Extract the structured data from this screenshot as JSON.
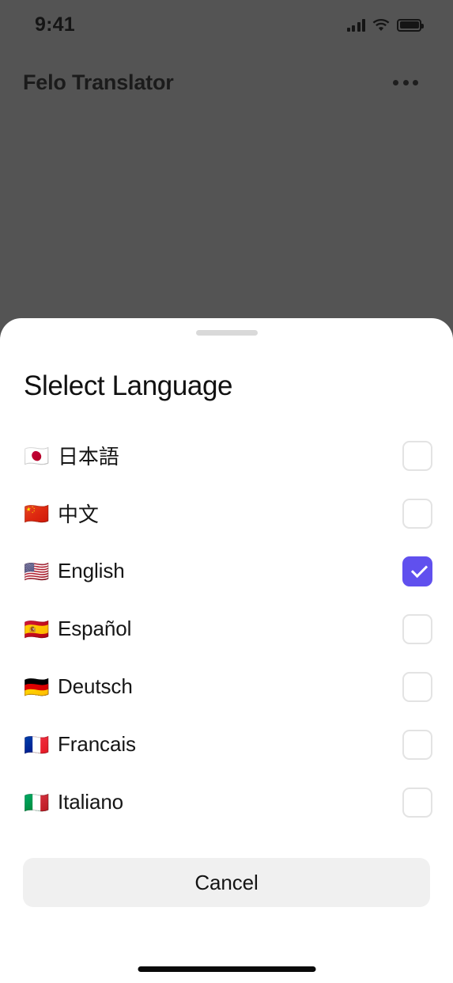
{
  "status_bar": {
    "time": "9:41",
    "signal_icon": "signal-bars-icon",
    "wifi_icon": "wifi-icon",
    "battery_icon": "battery-full-icon"
  },
  "app_header": {
    "title": "Felo Translator",
    "more_icon": "ellipsis-horizontal-icon"
  },
  "sheet": {
    "handle_icon": "drag-handle-icon",
    "title": "Slelect Language",
    "cancel_label": "Cancel",
    "accent_color": "#6050ee",
    "checkbox_border_color": "#e3e3e3",
    "cancel_bg_color": "#f0f0f0",
    "backdrop_color": "#545454",
    "languages": [
      {
        "label": "日本語",
        "flag": "🇯🇵",
        "flag_name": "flag-japan-icon",
        "checked": false
      },
      {
        "label": "中文",
        "flag": "🇨🇳",
        "flag_name": "flag-china-icon",
        "checked": false
      },
      {
        "label": "English",
        "flag": "🇺🇸",
        "flag_name": "flag-united-states-icon",
        "checked": true
      },
      {
        "label": "Español",
        "flag": "🇪🇸",
        "flag_name": "flag-spain-icon",
        "checked": false
      },
      {
        "label": "Deutsch",
        "flag": "🇩🇪",
        "flag_name": "flag-germany-icon",
        "checked": false
      },
      {
        "label": "Francais",
        "flag": "🇫🇷",
        "flag_name": "flag-france-icon",
        "checked": false
      },
      {
        "label": "Italiano",
        "flag": "🇮🇹",
        "flag_name": "flag-italy-icon",
        "checked": false
      }
    ]
  },
  "home_indicator": {
    "icon": "home-indicator-bar"
  }
}
